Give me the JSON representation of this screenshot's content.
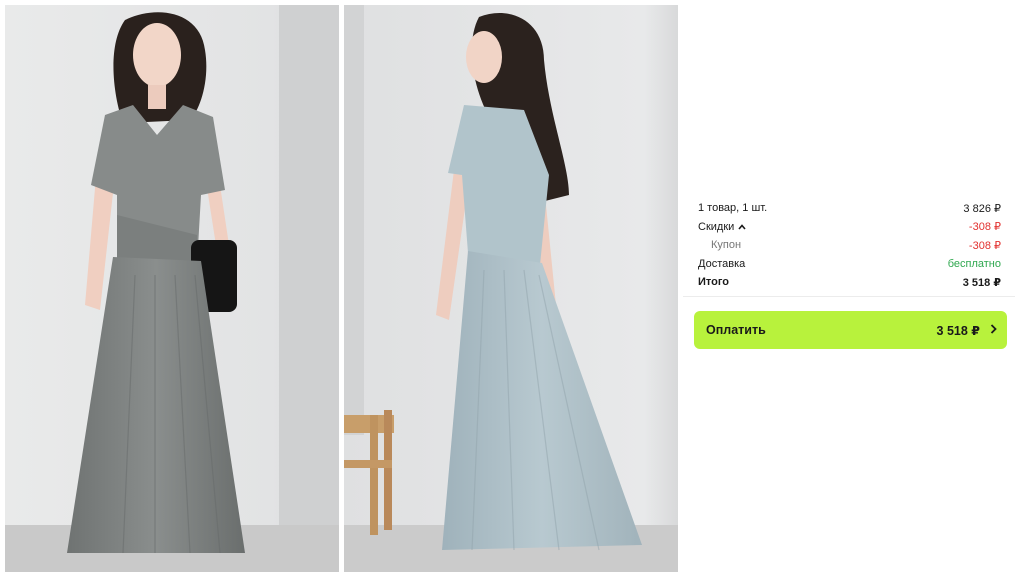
{
  "images": [
    {
      "subject": "woman-in-grey-wrap-dress-front-view"
    },
    {
      "subject": "woman-in-light-blue-dress-back-view"
    }
  ],
  "summary": {
    "items_label": "1 товар, 1 шт.",
    "items_value": "3 826 ₽",
    "discounts_label": "Скидки",
    "discounts_value": "-308 ₽",
    "coupon_label": "Купон",
    "coupon_value": "-308 ₽",
    "delivery_label": "Доставка",
    "delivery_value": "бесплатно",
    "total_label": "Итого",
    "total_value": "3 518 ₽"
  },
  "pay_button": {
    "label": "Оплатить",
    "amount": "3 518 ₽"
  },
  "colors": {
    "accent": "#b8f23c",
    "discount": "#e2312f",
    "free": "#2fa84f"
  }
}
